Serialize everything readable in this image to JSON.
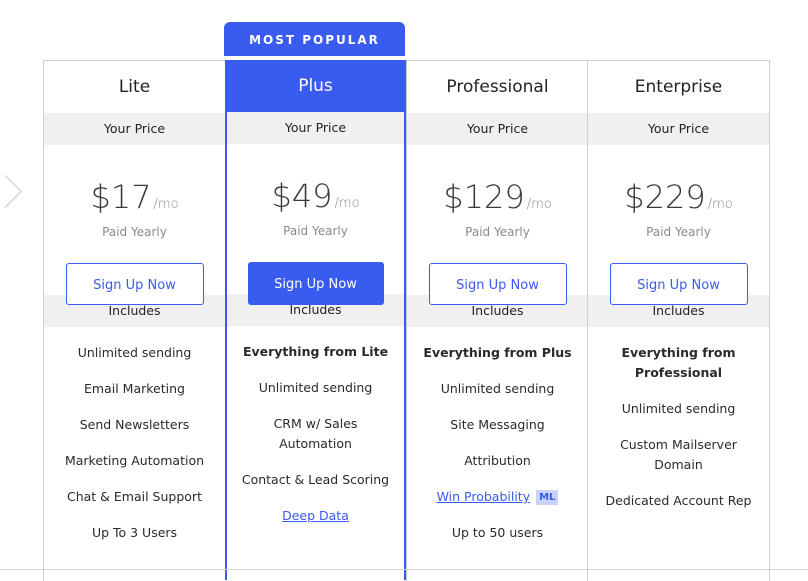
{
  "badge": {
    "label": "MOST POPULAR"
  },
  "colors": {
    "accent": "#3a5bef",
    "band": "#f0f0f0",
    "ml_badge_bg": "#c8d3fb"
  },
  "plans": [
    {
      "name": "Lite",
      "price_label": "Your Price",
      "price": "$17",
      "period": "/mo",
      "billing": "Paid Yearly",
      "cta": "Sign Up Now",
      "includes_label": "Includes",
      "features": [
        {
          "text": "Unlimited sending"
        },
        {
          "text": "Email Marketing"
        },
        {
          "text": "Send Newsletters"
        },
        {
          "text": "Marketing Automation"
        },
        {
          "text": "Chat & Email Support"
        },
        {
          "text": "Up To 3 Users"
        }
      ]
    },
    {
      "name": "Plus",
      "featured": true,
      "price_label": "Your Price",
      "price": "$49",
      "period": "/mo",
      "billing": "Paid Yearly",
      "cta": "Sign Up Now",
      "includes_label": "Includes",
      "features": [
        {
          "text": "Everything from Lite",
          "bold": true
        },
        {
          "text": "Unlimited sending"
        },
        {
          "text": "CRM w/ Sales Automation"
        },
        {
          "text": "Contact & Lead Scoring"
        },
        {
          "text": "Deep Data",
          "link": true
        }
      ]
    },
    {
      "name": "Professional",
      "price_label": "Your Price",
      "price": "$129",
      "period": "/mo",
      "billing": "Paid Yearly",
      "cta": "Sign Up Now",
      "includes_label": "Includes",
      "features": [
        {
          "text": "Everything from Plus",
          "bold": true
        },
        {
          "text": "Unlimited sending"
        },
        {
          "text": "Site Messaging"
        },
        {
          "text": "Attribution"
        },
        {
          "text": "Win Probability",
          "link": true,
          "badge": "ML"
        },
        {
          "text": "Up to 50 users"
        }
      ]
    },
    {
      "name": "Enterprise",
      "price_label": "Your Price",
      "price": "$229",
      "period": "/mo",
      "billing": "Paid Yearly",
      "cta": "Sign Up Now",
      "includes_label": "Includes",
      "features": [
        {
          "text": "Everything from Professional",
          "bold": true
        },
        {
          "text": "Unlimited sending"
        },
        {
          "text": "Custom Mailserver Domain"
        },
        {
          "text": "Dedicated Account Rep"
        }
      ]
    }
  ]
}
